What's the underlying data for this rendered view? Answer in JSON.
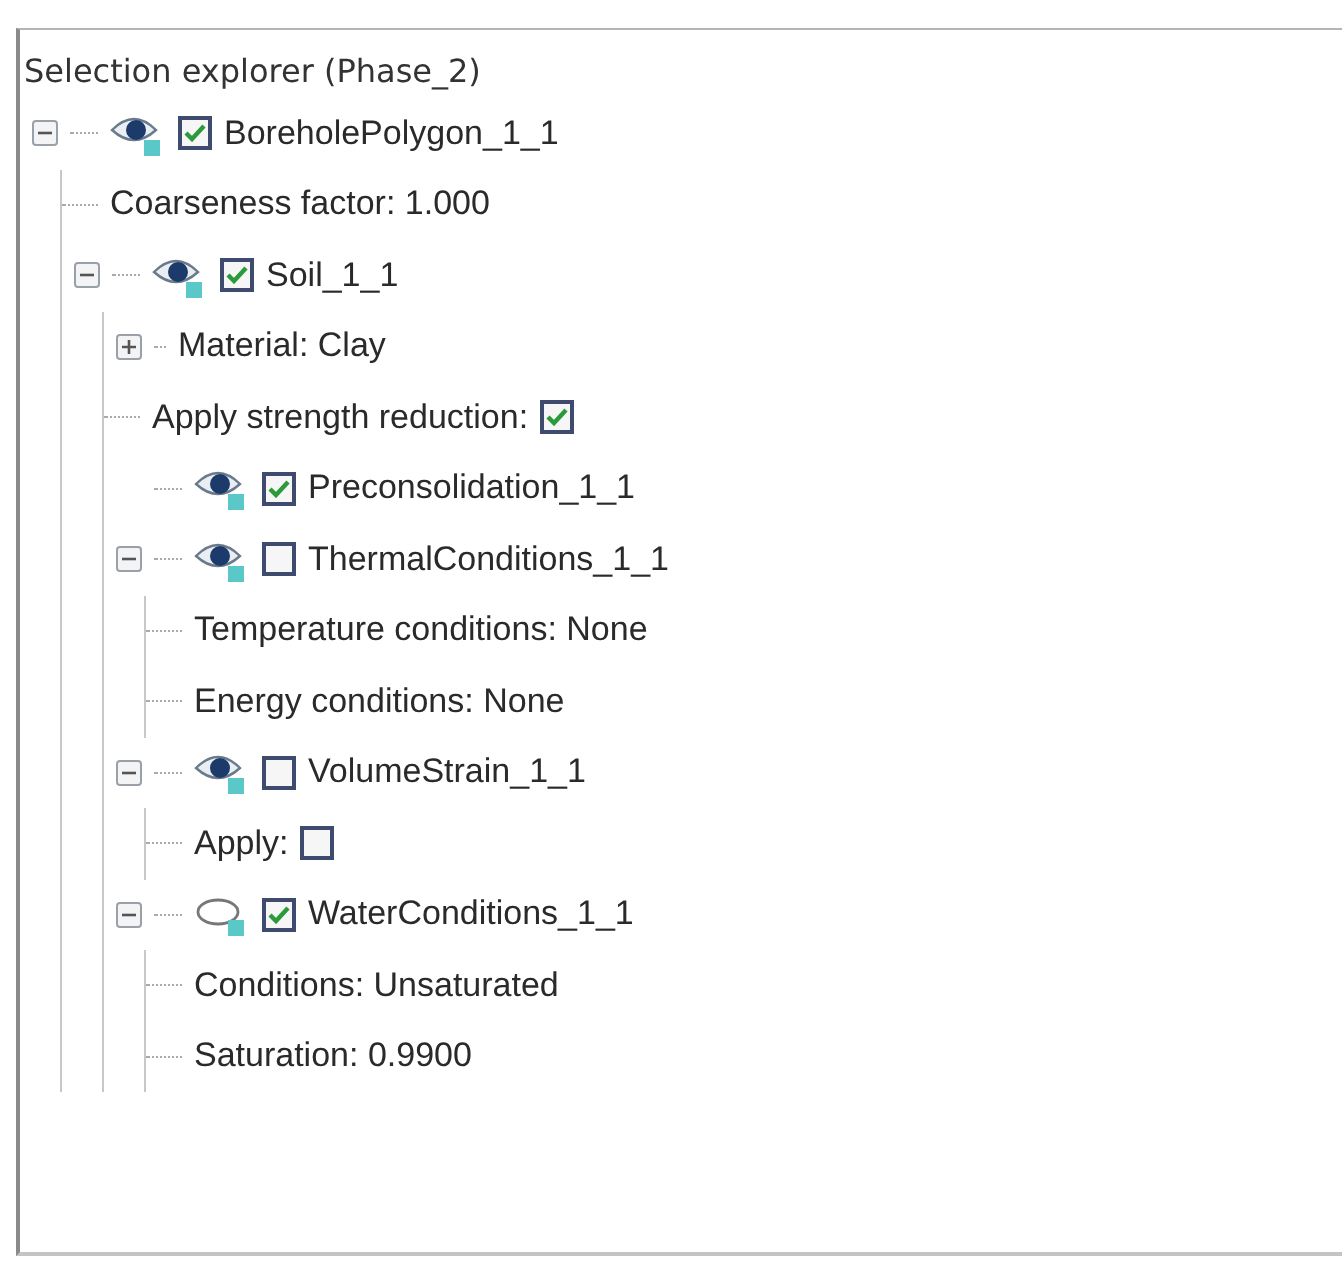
{
  "panel": {
    "title": "Selection explorer (Phase_2)"
  },
  "tree": [
    {
      "kind": "object",
      "label": "BoreholePolygon_1_1",
      "expanded": true,
      "visible": true,
      "checked": true,
      "children": [
        {
          "kind": "property",
          "label": "Coarseness factor: 1.000"
        },
        {
          "kind": "object",
          "label": "Soil_1_1",
          "expanded": true,
          "visible": true,
          "checked": true,
          "children": [
            {
              "kind": "group",
              "label": "Material: Clay",
              "expanded": false
            },
            {
              "kind": "check-property",
              "label": "Apply strength reduction:",
              "checked": true
            },
            {
              "kind": "object",
              "label": "Preconsolidation_1_1",
              "visible": true,
              "checked": true
            },
            {
              "kind": "object",
              "label": "ThermalConditions_1_1",
              "expanded": true,
              "visible": true,
              "checked": false,
              "children": [
                {
                  "kind": "property",
                  "label": "Temperature conditions: None"
                },
                {
                  "kind": "property",
                  "label": "Energy conditions: None"
                }
              ]
            },
            {
              "kind": "object",
              "label": "VolumeStrain_1_1",
              "expanded": true,
              "visible": true,
              "checked": false,
              "children": [
                {
                  "kind": "check-property",
                  "label": "Apply:",
                  "checked": false
                }
              ]
            },
            {
              "kind": "object",
              "label": "WaterConditions_1_1",
              "expanded": true,
              "visible": false,
              "checked": true,
              "children": [
                {
                  "kind": "property",
                  "label": "Conditions: Unsaturated"
                },
                {
                  "kind": "property",
                  "label": "Saturation: 0.9900"
                }
              ]
            }
          ]
        }
      ]
    }
  ]
}
